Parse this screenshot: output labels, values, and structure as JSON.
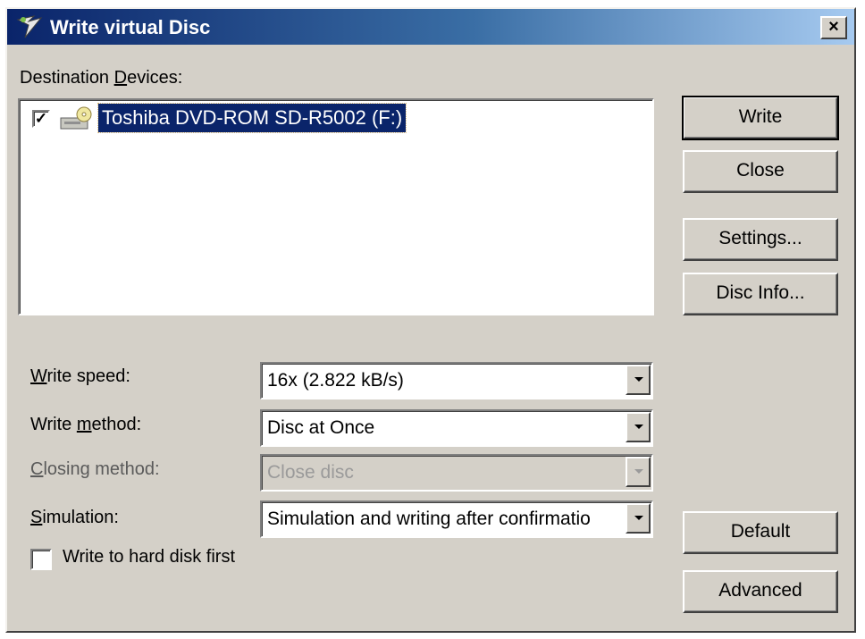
{
  "window": {
    "title": "Write virtual Disc",
    "close_label": "×"
  },
  "devices": {
    "label_pre": "Destination ",
    "label_ul": "D",
    "label_post": "evices:",
    "items": [
      {
        "name": "Toshiba DVD-ROM SD-R5002 (F:)",
        "checked": true,
        "check_glyph": "✓"
      }
    ]
  },
  "buttons": {
    "write": "Write",
    "close": "Close",
    "settings": "Settings...",
    "disc_info": "Disc Info...",
    "default": "Default",
    "advanced": "Advanced"
  },
  "fields": {
    "write_speed": {
      "label_ul": "W",
      "label_rest": "rite speed:",
      "value": "16x (2.822 kB/s)"
    },
    "write_method": {
      "label_pre": "Write ",
      "label_ul": "m",
      "label_rest": "ethod:",
      "value": "Disc at Once"
    },
    "closing_method": {
      "label_ul": "C",
      "label_rest": "losing method:",
      "value": "Close disc",
      "disabled": true
    },
    "simulation": {
      "label_ul": "S",
      "label_rest": "imulation:",
      "value": "Simulation and writing after confirmatio"
    }
  },
  "write_to_hdd": {
    "label": "Write to hard disk first",
    "checked": false
  },
  "icons": {
    "title": "burn-app-icon",
    "device": "cd-drive-icon"
  }
}
